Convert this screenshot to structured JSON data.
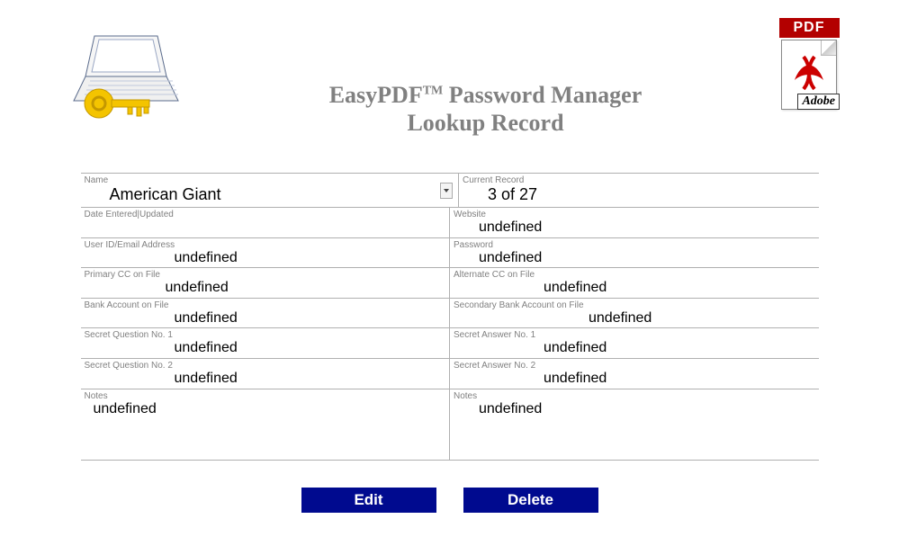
{
  "header": {
    "title_line1_a": "EasyPDF",
    "title_line1_tm": "TM",
    "title_line1_b": " Password Manager",
    "title_line2": "Lookup Record",
    "pdf_badge": "PDF",
    "adobe_tag": "Adobe"
  },
  "labels": {
    "name": "Name",
    "current_record": "Current Record",
    "date_entered": "Date Entered|Updated",
    "website": "Website",
    "user_id": "User ID/Email Address",
    "password": "Password",
    "primary_cc": "Primary CC on File",
    "alternate_cc": "Alternate CC on File",
    "bank_account": "Bank Account on File",
    "secondary_bank": "Secondary Bank Account on File",
    "secret_q1": "Secret Question No. 1",
    "secret_a1": "Secret Answer No. 1",
    "secret_q2": "Secret Question No. 2",
    "secret_a2": "Secret Answer No. 2",
    "notes": "Notes"
  },
  "values": {
    "name": "American Giant",
    "current_record": "3 of 27",
    "date_entered": "",
    "website": "undefined",
    "user_id": "undefined",
    "password": "undefined",
    "primary_cc": "undefined",
    "alternate_cc": "undefined",
    "bank_account": "undefined",
    "secondary_bank": "undefined",
    "secret_q1": "undefined",
    "secret_a1": "undefined",
    "secret_q2": "undefined",
    "secret_a2": "undefined",
    "notes_left": "undefined",
    "notes_right": "undefined"
  },
  "buttons": {
    "edit": "Edit",
    "delete": "Delete"
  }
}
